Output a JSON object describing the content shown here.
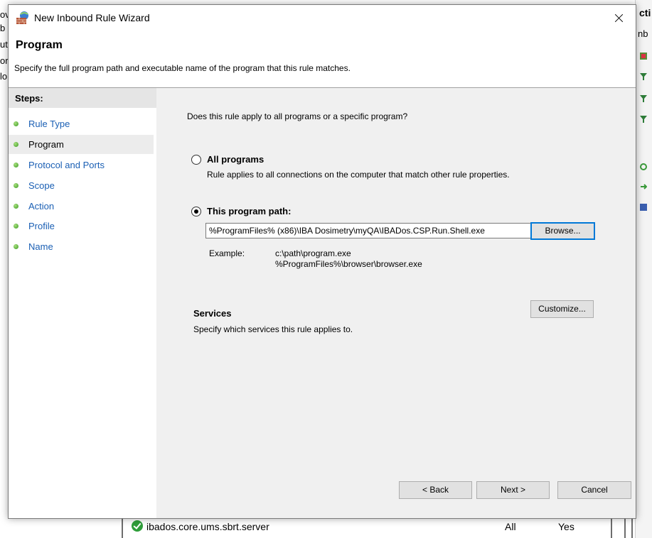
{
  "background": {
    "left_fragments": [
      "ov",
      "b",
      "ut",
      "or",
      "lo"
    ],
    "right_header": "cti",
    "right_sub": "nb",
    "list_row": {
      "name": "ibados.core.ums.sbrt.server",
      "profile": "All",
      "enabled": "Yes"
    }
  },
  "dialog": {
    "title": "New Inbound Rule Wizard",
    "page_title": "Program",
    "page_description": "Specify the full program path and executable name of the program that this rule matches."
  },
  "steps": {
    "title": "Steps:",
    "items": [
      {
        "label": "Rule Type"
      },
      {
        "label": "Program"
      },
      {
        "label": "Protocol and Ports"
      },
      {
        "label": "Scope"
      },
      {
        "label": "Action"
      },
      {
        "label": "Profile"
      },
      {
        "label": "Name"
      }
    ],
    "active_index": 1
  },
  "content": {
    "question": "Does this rule apply to all programs or a specific program?",
    "all_programs": {
      "label": "All programs",
      "description": "Rule applies to all connections on the computer that match other rule properties.",
      "selected": false
    },
    "program_path": {
      "label": "This program path:",
      "value": "%ProgramFiles% (x86)\\IBA Dosimetry\\myQA\\IBADos.CSP.Run.Shell.exe",
      "selected": true,
      "browse_label": "Browse..."
    },
    "example": {
      "label": "Example:",
      "lines": [
        "c:\\path\\program.exe",
        "%ProgramFiles%\\browser\\browser.exe"
      ]
    },
    "services": {
      "title": "Services",
      "description": "Specify which services this rule applies to.",
      "customize_label": "Customize..."
    }
  },
  "footer": {
    "back_label": "< Back",
    "next_label": "Next >",
    "cancel_label": "Cancel"
  },
  "colors": {
    "step_link": "#1a5fb4",
    "panel_bg": "#f0f0f0",
    "step_dot": "#3c9a24",
    "default_button_border": "#0078d7"
  }
}
